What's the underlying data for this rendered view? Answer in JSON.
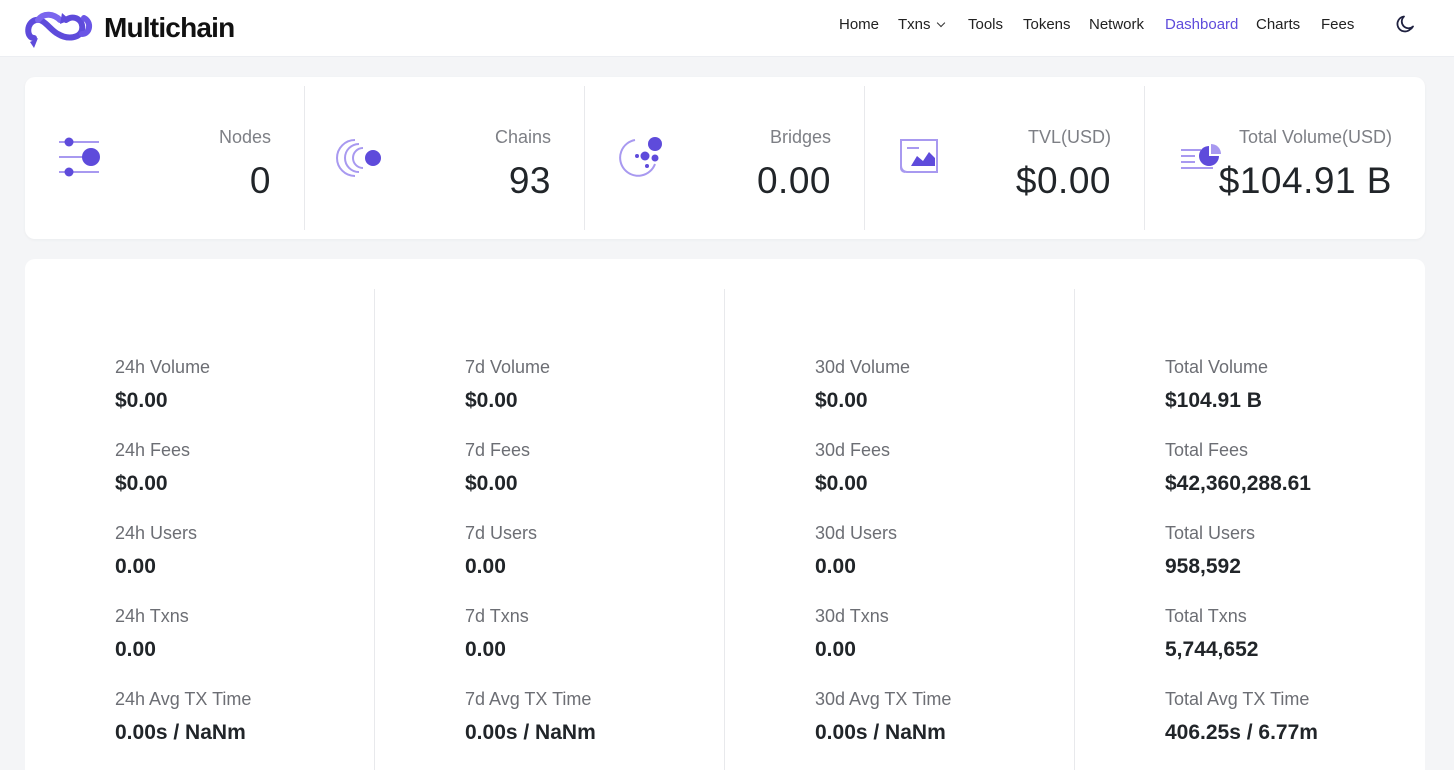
{
  "header": {
    "brand": "Multichain",
    "nav": [
      {
        "label": "Home",
        "active": false
      },
      {
        "label": "Txns",
        "active": false,
        "dropdown": true
      },
      {
        "label": "Tools",
        "active": false
      },
      {
        "label": "Tokens",
        "active": false
      },
      {
        "label": "Network",
        "active": false
      },
      {
        "label": "Dashboard",
        "active": true
      },
      {
        "label": "Charts",
        "active": false
      },
      {
        "label": "Fees",
        "active": false
      }
    ],
    "theme_icon": "moon-icon"
  },
  "stats": [
    {
      "label": "Nodes",
      "value": "0",
      "icon": "nodes-icon"
    },
    {
      "label": "Chains",
      "value": "93",
      "icon": "chains-icon"
    },
    {
      "label": "Bridges",
      "value": "0.00",
      "icon": "bridges-icon"
    },
    {
      "label": "TVL(USD)",
      "value": "$0.00",
      "icon": "tvl-icon"
    },
    {
      "label": "Total Volume(USD)",
      "value": "$104.91 B",
      "icon": "total-volume-icon"
    }
  ],
  "metrics": [
    {
      "items": [
        {
          "label": "24h Volume",
          "value": "$0.00"
        },
        {
          "label": "24h Fees",
          "value": "$0.00"
        },
        {
          "label": "24h Users",
          "value": "0.00"
        },
        {
          "label": "24h Txns",
          "value": "0.00"
        },
        {
          "label": "24h Avg TX Time",
          "value": "0.00s / NaNm"
        }
      ]
    },
    {
      "items": [
        {
          "label": "7d Volume",
          "value": "$0.00"
        },
        {
          "label": "7d Fees",
          "value": "$0.00"
        },
        {
          "label": "7d Users",
          "value": "0.00"
        },
        {
          "label": "7d Txns",
          "value": "0.00"
        },
        {
          "label": "7d Avg TX Time",
          "value": "0.00s / NaNm"
        }
      ]
    },
    {
      "items": [
        {
          "label": "30d Volume",
          "value": "$0.00"
        },
        {
          "label": "30d Fees",
          "value": "$0.00"
        },
        {
          "label": "30d Users",
          "value": "0.00"
        },
        {
          "label": "30d Txns",
          "value": "0.00"
        },
        {
          "label": "30d Avg TX Time",
          "value": "0.00s / NaNm"
        }
      ]
    },
    {
      "items": [
        {
          "label": "Total Volume",
          "value": "$104.91 B"
        },
        {
          "label": "Total Fees",
          "value": "$42,360,288.61"
        },
        {
          "label": "Total Users",
          "value": "958,592"
        },
        {
          "label": "Total Txns",
          "value": "5,744,652"
        },
        {
          "label": "Total Avg TX Time",
          "value": "406.25s / 6.77m"
        }
      ]
    }
  ],
  "colors": {
    "accent": "#5e4bdb",
    "accent_light": "#a899f0",
    "background": "#f4f5f7"
  }
}
